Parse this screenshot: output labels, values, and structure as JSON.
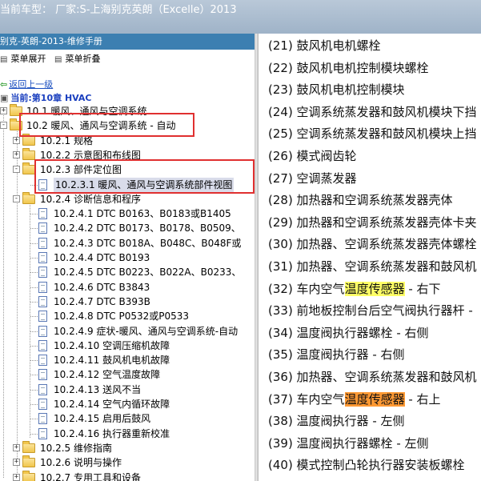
{
  "window": {
    "title": "当前车型：  厂家:S-上海别克英朗（Excelle）2013"
  },
  "left": {
    "header": "别克-英朗-2013-维修手册",
    "toolbar": {
      "expand_label": "菜单展开",
      "collapse_label": "菜单折叠"
    },
    "back_link": "返回上一级",
    "current": "当前:第10章 HVAC",
    "tree": [
      {
        "label": "10.1 暖风、通风与空调系统",
        "expander": "+"
      },
      {
        "label": "10.2 暖风、通风与空调系统 - 自动",
        "expander": "-"
      },
      {
        "label": "10.2.1 规格",
        "expander": "+"
      },
      {
        "label": "10.2.2 示意图和布线图",
        "expander": "+"
      },
      {
        "label": "10.2.3 部件定位图",
        "expander": "-"
      },
      {
        "label": "10.2.3.1 暖风、通风与空调系统部件视图",
        "selected": true
      },
      {
        "label": "10.2.4 诊断信息和程序",
        "expander": "-"
      },
      {
        "label": "10.2.4.1 DTC B0163、B0183或B1405"
      },
      {
        "label": "10.2.4.2 DTC B0173、B0178、B0509、"
      },
      {
        "label": "10.2.4.3 DTC B018A、B048C、B048F或"
      },
      {
        "label": "10.2.4.4 DTC B0193"
      },
      {
        "label": "10.2.4.5 DTC B0223、B022A、B0233、"
      },
      {
        "label": "10.2.4.6 DTC B3843"
      },
      {
        "label": "10.2.4.7 DTC B393B"
      },
      {
        "label": "10.2.4.8 DTC P0532或P0533"
      },
      {
        "label": "10.2.4.9 症状-暖风、通风与空调系统-自动"
      },
      {
        "label": "10.2.4.10 空调压缩机故障"
      },
      {
        "label": "10.2.4.11 鼓风机电机故障"
      },
      {
        "label": "10.2.4.12 空气温度故障"
      },
      {
        "label": "10.2.4.13 送风不当"
      },
      {
        "label": "10.2.4.14 空气内循环故障"
      },
      {
        "label": "10.2.4.15 启用后鼓风"
      },
      {
        "label": "10.2.4.16 执行器重新校准"
      },
      {
        "label": "10.2.5 维修指南",
        "expander": "+"
      },
      {
        "label": "10.2.6 说明与操作",
        "expander": "+"
      },
      {
        "label": "10.2.7 专用工具和设备",
        "expander": "+"
      }
    ]
  },
  "right": {
    "parts": [
      {
        "pre": "(21) 鼓风机电机螺栓",
        "hl": "",
        "post": ""
      },
      {
        "pre": "(22) 鼓风机电机控制模块螺栓",
        "hl": "",
        "post": ""
      },
      {
        "pre": "(23) 鼓风机电机控制模块",
        "hl": "",
        "post": ""
      },
      {
        "pre": "(24) 空调系统蒸发器和鼓风机模块下挡",
        "hl": "",
        "post": ""
      },
      {
        "pre": "(25) 空调系统蒸发器和鼓风机模块上挡",
        "hl": "",
        "post": ""
      },
      {
        "pre": "(26) 模式阀齿轮",
        "hl": "",
        "post": ""
      },
      {
        "pre": "(27) 空调蒸发器",
        "hl": "",
        "post": ""
      },
      {
        "pre": "(28) 加热器和空调系统蒸发器壳体",
        "hl": "",
        "post": ""
      },
      {
        "pre": "(29) 加热器和空调系统蒸发器壳体卡夹",
        "hl": "",
        "post": ""
      },
      {
        "pre": "(30) 加热器、空调系统蒸发器壳体螺栓",
        "hl": "",
        "post": ""
      },
      {
        "pre": "(31) 加热器、空调系统蒸发器和鼓风机",
        "hl": "",
        "post": ""
      },
      {
        "pre": "(32) 车内空气",
        "hl": "温度传感器",
        "post": " - 右下"
      },
      {
        "pre": "(33) 前地板控制台后空气阀执行器杆 -",
        "hl": "",
        "post": ""
      },
      {
        "pre": "(34) 温度阀执行器螺栓 - 右侧",
        "hl": "",
        "post": ""
      },
      {
        "pre": "(35) 温度阀执行器 - 右侧",
        "hl": "",
        "post": ""
      },
      {
        "pre": "(36) 加热器、空调系统蒸发器和鼓风机",
        "hl": "",
        "post": ""
      },
      {
        "pre": "(37) 车内空气",
        "hl": "温度传感器",
        "post": " - 右上"
      },
      {
        "pre": "(38) 温度阀执行器 - 左侧",
        "hl": "",
        "post": ""
      },
      {
        "pre": "(39) 温度阀执行器螺栓 - 左侧",
        "hl": "",
        "post": ""
      },
      {
        "pre": "(40) 模式控制凸轮执行器安装板螺栓",
        "hl": "",
        "post": ""
      }
    ]
  },
  "colors": {
    "titlebar": "#9fb3c8",
    "header": "#3c7fb1",
    "highlight_yellow": "#ffff66",
    "highlight_orange": "#ff9933",
    "red_box": "#e03030"
  }
}
